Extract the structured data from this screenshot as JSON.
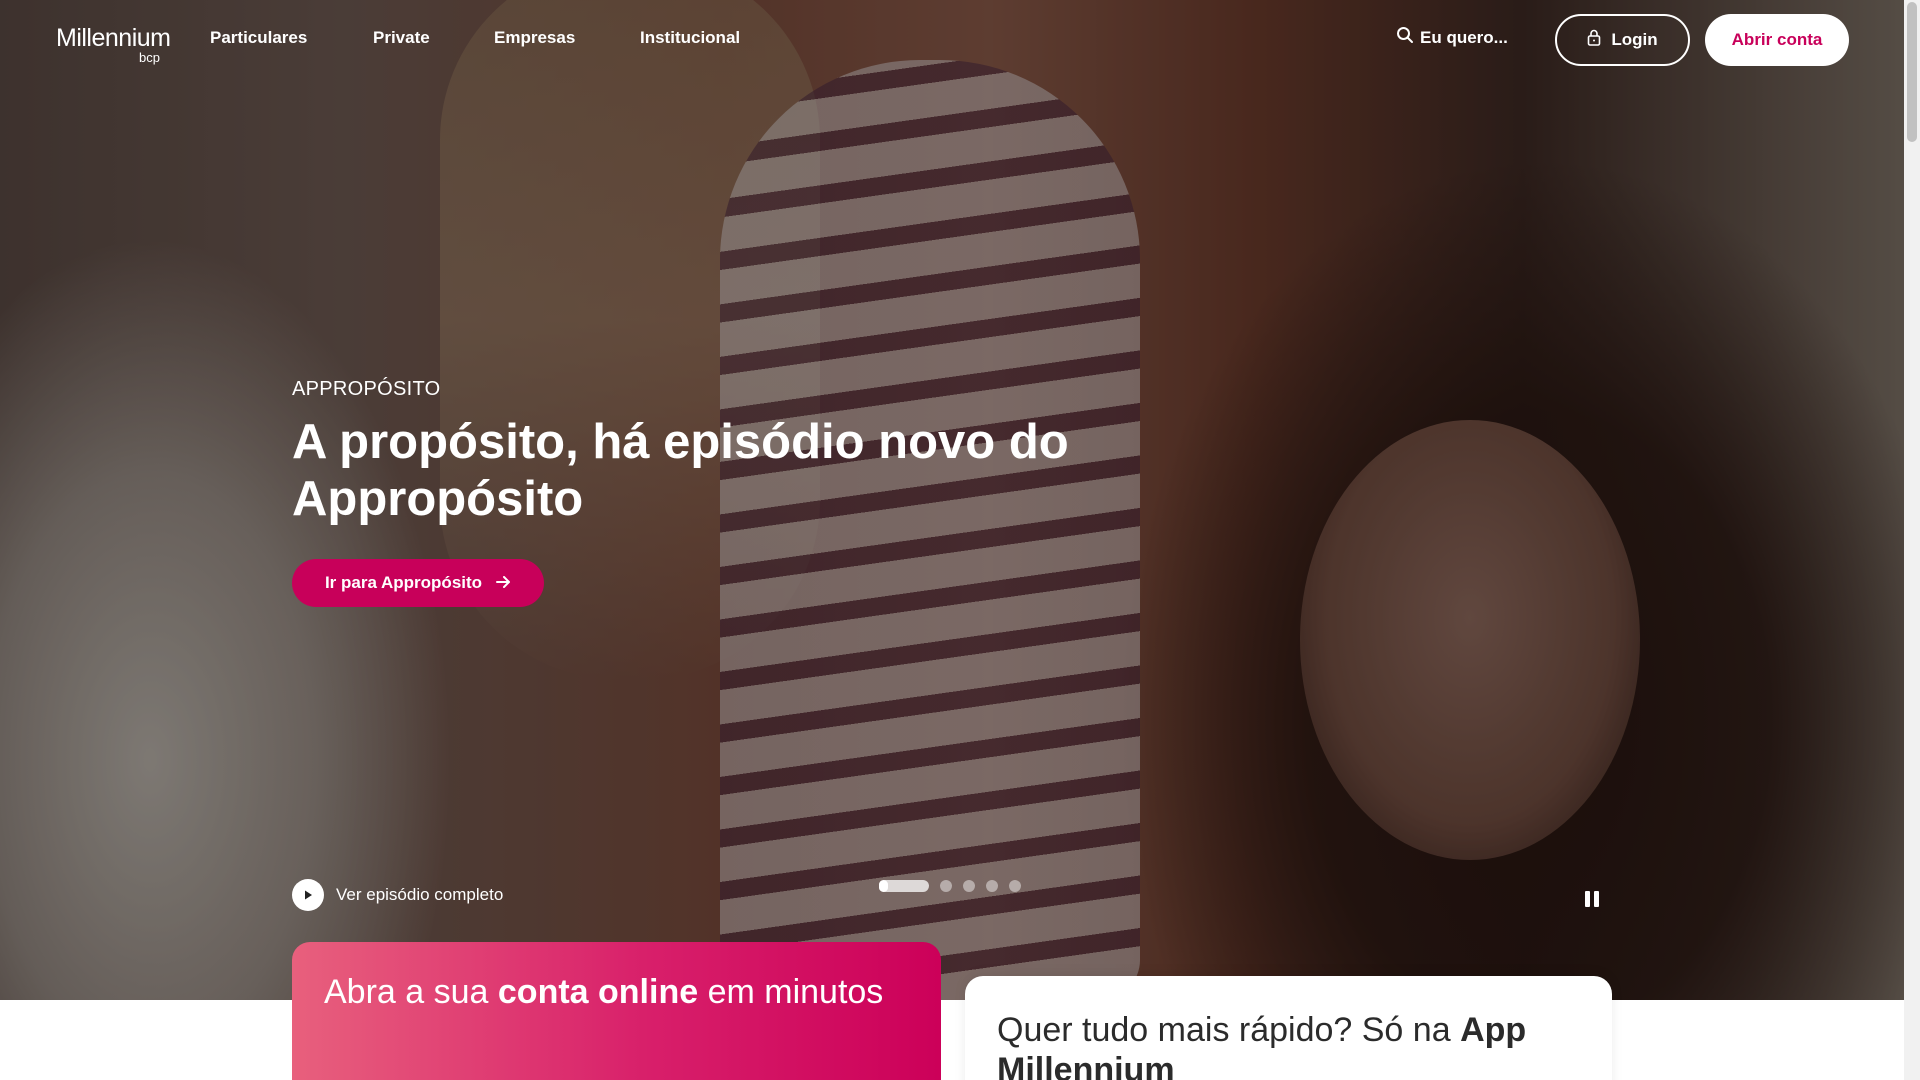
{
  "brand": {
    "name": "Millennium",
    "sub": "bcp"
  },
  "nav": {
    "items": [
      {
        "label": "Particulares"
      },
      {
        "label": "Private"
      },
      {
        "label": "Empresas"
      },
      {
        "label": "Institucional"
      }
    ],
    "search_label": "Eu quero...",
    "login_label": "Login",
    "open_account_label": "Abrir conta",
    "icons": {
      "search": "search-icon",
      "lock": "lock-icon"
    }
  },
  "hero": {
    "eyebrow": "APPROPÓSITO",
    "title": "A propósito, há episódio novo do Appropósito",
    "cta_label": "Ir para Appropósito",
    "video_label": "Ver episódio completo",
    "slides_total": 5,
    "slide_active": 1
  },
  "cards": {
    "account": {
      "pre": "Abra a sua ",
      "bold": "conta online",
      "post": " em minutos"
    },
    "app": {
      "pre": "Quer tudo mais rápido? Só na ",
      "bold": "App Millennium"
    }
  },
  "colors": {
    "brand": "#c8005a",
    "brand_gradient_start": "#e8607d"
  }
}
